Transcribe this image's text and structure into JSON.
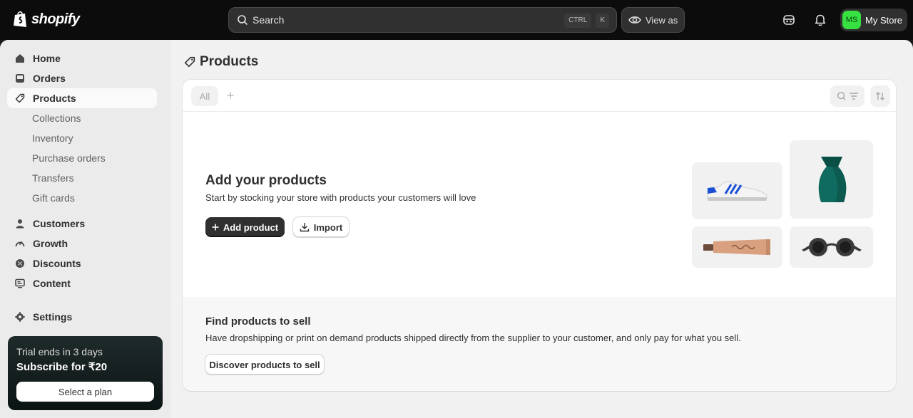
{
  "topbar": {
    "brand": "shopify",
    "search_placeholder": "Search",
    "search_key_1": "CTRL",
    "search_key_2": "K",
    "view_as_label": "View as",
    "store_initials": "MS",
    "store_name": "My Store"
  },
  "sidebar": {
    "home": "Home",
    "orders": "Orders",
    "products": "Products",
    "sub": [
      "Collections",
      "Inventory",
      "Purchase orders",
      "Transfers",
      "Gift cards"
    ],
    "customers": "Customers",
    "growth": "Growth",
    "discounts": "Discounts",
    "content": "Content",
    "settings": "Settings"
  },
  "trial": {
    "line1": "Trial ends in 3 days",
    "line2": "Subscribe for ₹20",
    "button": "Select a plan"
  },
  "main": {
    "title": "Products",
    "tab_all": "All",
    "tab_add": "+",
    "empty_title": "Add your products",
    "empty_sub": "Start by stocking your store with products your customers will love",
    "add_product": "Add product",
    "import": "Import",
    "find_title": "Find products to sell",
    "find_sub": "Have dropshipping or print on demand products shipped directly from the supplier to your customer, and only pay for what you sell.",
    "discover": "Discover products to sell"
  },
  "colors": {
    "topbar_bg": "#0c0c0c",
    "avatar_bg": "#36e141",
    "primary_btn": "#303030"
  }
}
